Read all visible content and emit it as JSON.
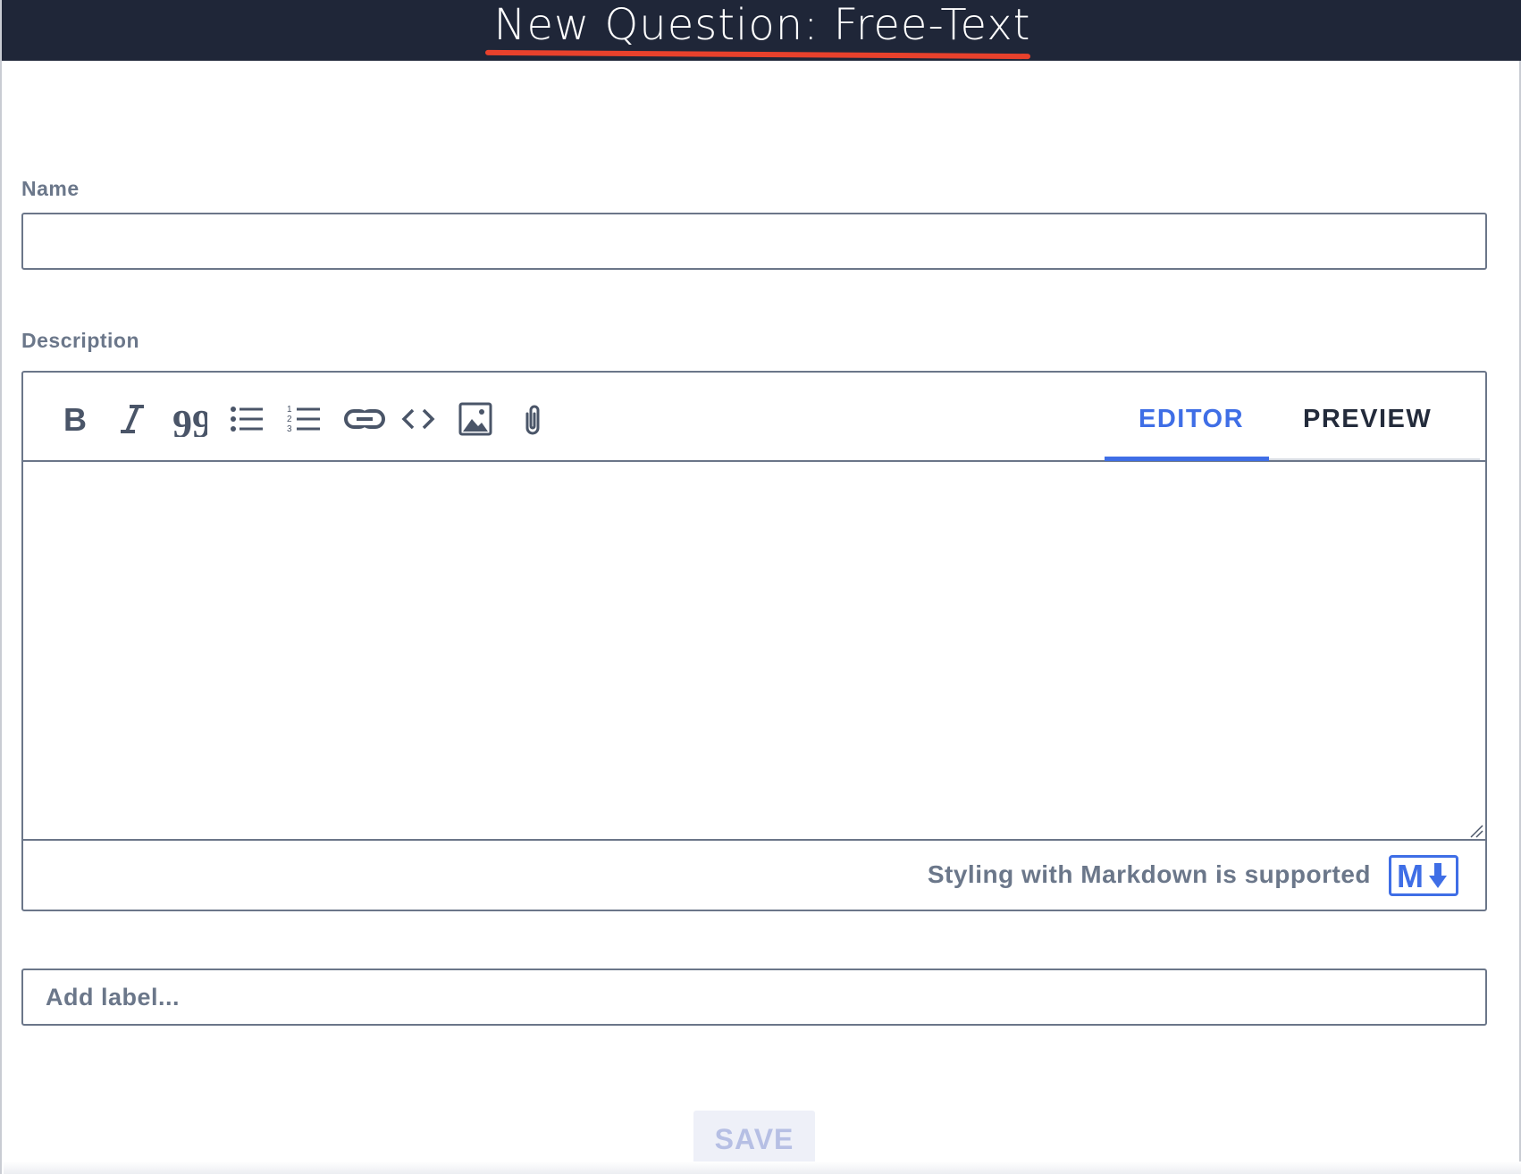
{
  "header": {
    "title": "New Question: Free-Text",
    "background": "#1f2638",
    "underline_color": "#e8412c"
  },
  "form": {
    "name_label": "Name",
    "name_value": "",
    "description_label": "Description",
    "description_value": "",
    "label_placeholder": "Add label...",
    "save_label": "SAVE"
  },
  "editor": {
    "toolbar": [
      {
        "icon": "bold-icon"
      },
      {
        "icon": "italic-icon"
      },
      {
        "icon": "quote-icon"
      },
      {
        "icon": "bulleted-list-icon"
      },
      {
        "icon": "numbered-list-icon"
      },
      {
        "icon": "link-icon"
      },
      {
        "icon": "code-icon"
      },
      {
        "icon": "image-icon"
      },
      {
        "icon": "attachment-icon"
      }
    ],
    "tabs": {
      "editor": "EDITOR",
      "preview": "PREVIEW",
      "active": "editor"
    },
    "markdown_note": "Styling with Markdown is supported",
    "accent_color": "#3f6ee6"
  }
}
